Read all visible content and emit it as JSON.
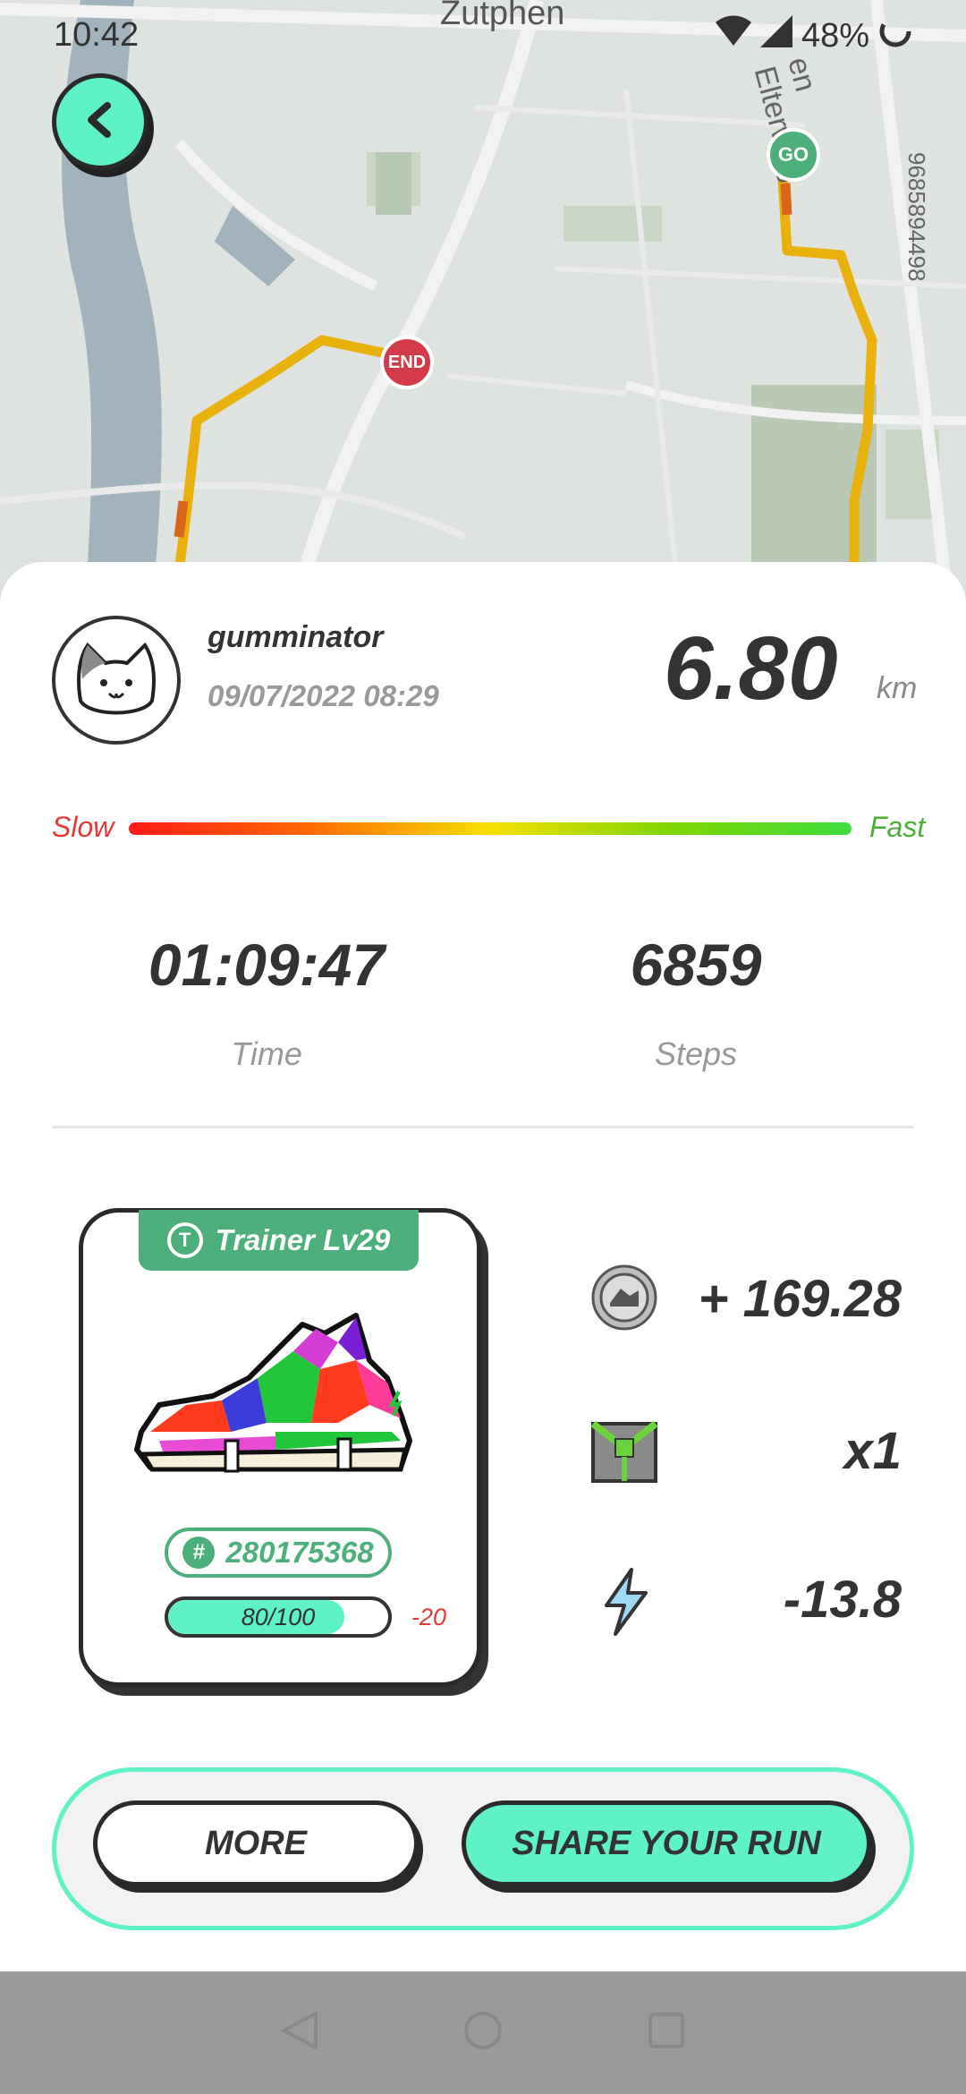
{
  "status_bar": {
    "time": "10:42",
    "battery": "48%"
  },
  "map": {
    "city_label": "Zutphen",
    "road_label": "en Elterweg",
    "number_label": "9685894498",
    "start_pin": "GO",
    "end_pin": "END"
  },
  "profile": {
    "username": "gumminator",
    "datetime": "09/07/2022 08:29",
    "distance": "6.80",
    "distance_unit": "km"
  },
  "speed_scale": {
    "slow": "Slow",
    "fast": "Fast"
  },
  "stats": {
    "time_value": "01:09:47",
    "time_label": "Time",
    "steps_value": "6859",
    "steps_label": "Steps"
  },
  "sneaker": {
    "type_level": "Trainer Lv29",
    "type_badge": "T",
    "id_prefix": "#",
    "id": "280175368",
    "durability": "80/100",
    "durability_fraction": 0.8,
    "durability_change": "-20"
  },
  "rewards": {
    "gst": "+ 169.28",
    "mystery_box": "x1",
    "energy": "-13.8"
  },
  "buttons": {
    "more": "MORE",
    "share": "SHARE YOUR RUN"
  },
  "colors": {
    "accent": "#5ff2c6",
    "brand_green": "#4caf7c",
    "negative": "#e53935",
    "end_pin": "#d43b4a"
  },
  "icons": [
    "back-arrow-icon",
    "wifi-icon",
    "signal-icon",
    "battery-icon",
    "gst-coin-icon",
    "mystery-box-icon",
    "energy-bolt-icon",
    "cat-avatar-icon"
  ]
}
